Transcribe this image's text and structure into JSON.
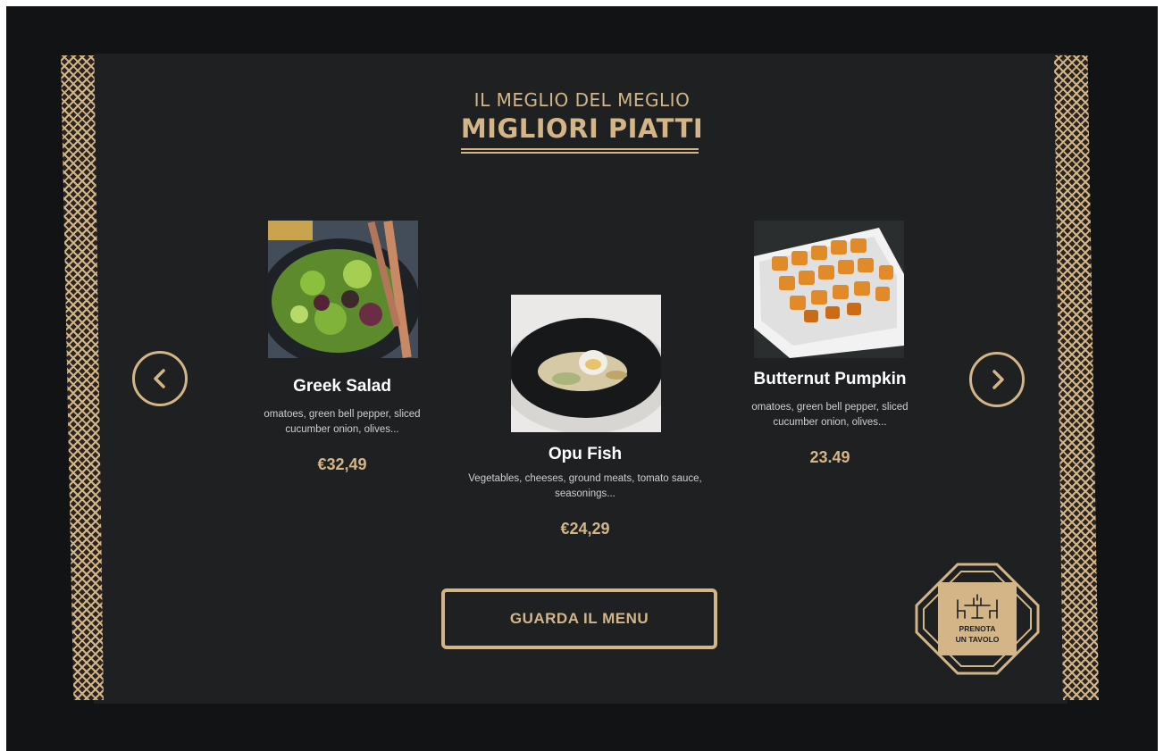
{
  "section": {
    "kicker": "IL MEGLIO DEL MEGLIO",
    "title": "MIGLIORI PIATTI"
  },
  "dishes": [
    {
      "name": "Greek Salad",
      "description": "omatoes, green bell pepper, sliced cucumber onion, olives...",
      "price": "€32,49"
    },
    {
      "name": "Opu Fish",
      "description": "Vegetables, cheeses, ground meats, tomato sauce, seasonings...",
      "price": "€24,29"
    },
    {
      "name": "Butternut Pumpkin",
      "description": "omatoes, green bell pepper, sliced cucumber onion, olives...",
      "price": "23.49"
    }
  ],
  "cta": {
    "menu_label": "GUARDA IL MENU"
  },
  "reserve": {
    "line1": "PRENOTA",
    "line2": "UN TAVOLO"
  },
  "colors": {
    "accent": "#d3b587",
    "panel": "#1f2022",
    "frame": "#121314"
  },
  "icons": {
    "prev": "chevron-left-icon",
    "next": "chevron-right-icon",
    "reserve": "dining-table-icon"
  }
}
